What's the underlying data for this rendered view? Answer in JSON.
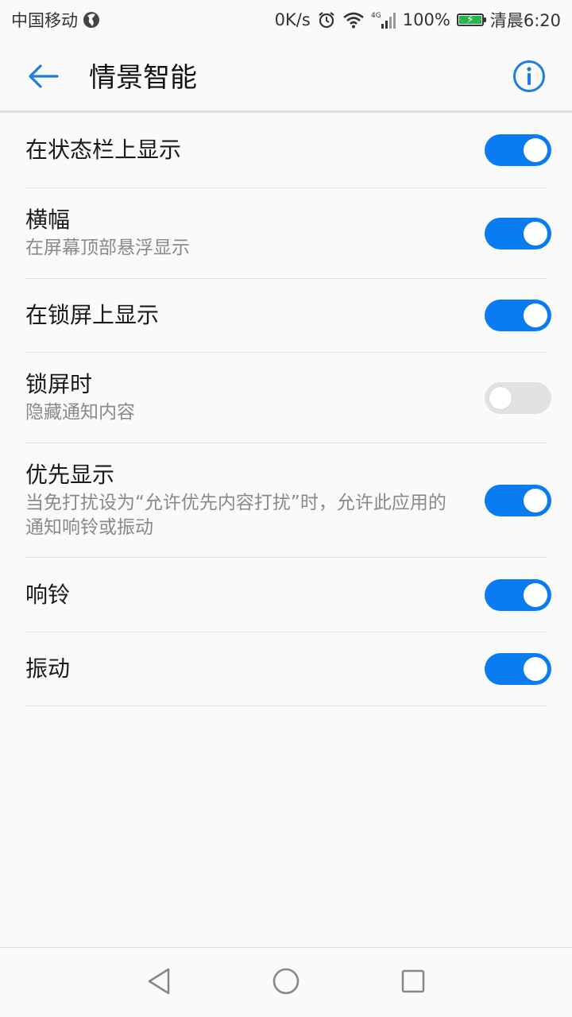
{
  "status_bar": {
    "carrier": "中国移动",
    "net_speed": "0K/s",
    "network_type": "4G",
    "battery": "100%",
    "battery_level": 1.0,
    "time": "清晨6:20",
    "icons": [
      "globe-icon",
      "alarm-icon",
      "wifi-icon",
      "signal-icon",
      "battery-icon"
    ]
  },
  "app_bar": {
    "title": "情景智能",
    "back_icon": "arrow-left-icon",
    "info_icon": "info-icon",
    "accent_color": "#1a7fe0"
  },
  "settings": [
    {
      "title": "在状态栏上显示",
      "subtitle": "",
      "enabled": true
    },
    {
      "title": "横幅",
      "subtitle": "在屏幕顶部悬浮显示",
      "enabled": true
    },
    {
      "title": "在锁屏上显示",
      "subtitle": "",
      "enabled": true
    },
    {
      "title": "锁屏时",
      "subtitle": "隐藏通知内容",
      "enabled": false
    },
    {
      "title": "优先显示",
      "subtitle": "当免打扰设为“允许优先内容打扰”时，允许此应用的通知响铃或振动",
      "enabled": true
    },
    {
      "title": "响铃",
      "subtitle": "",
      "enabled": true
    },
    {
      "title": "振动",
      "subtitle": "",
      "enabled": true
    }
  ],
  "colors": {
    "toggle_on": "#0a7cf1",
    "toggle_off": "#e2e2e2",
    "battery_fill": "#27b64a"
  },
  "nav_bar": {
    "icons": [
      "back-triangle-icon",
      "home-circle-icon",
      "recents-square-icon"
    ]
  }
}
